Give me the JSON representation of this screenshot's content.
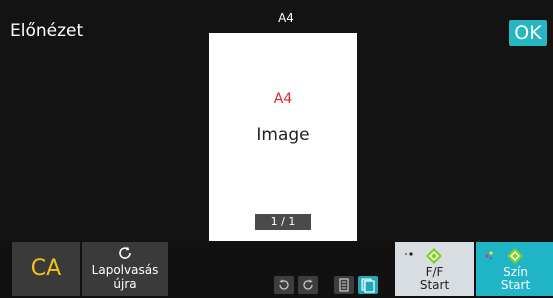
{
  "header": {
    "title": "Előnézet",
    "paper_size": "A4",
    "ok_label": "OK"
  },
  "preview": {
    "size_text": "A4",
    "image_text": "Image",
    "page_counter": "1 / 1"
  },
  "toolbar": {
    "ca_label": "CA",
    "rescan_line1": "Lapolvasás",
    "rescan_line2": "újra",
    "rotate_left_icon": "rotate-left-icon",
    "rotate_right_icon": "rotate-right-icon",
    "single_page_icon": "single-page-view-icon",
    "multi_page_icon": "multi-page-view-icon"
  },
  "start_buttons": {
    "bw_line1": "F/F",
    "bw_line2": "Start",
    "color_line1": "Szín",
    "color_line2": "Start"
  },
  "colors": {
    "accent_teal": "#25b6c0",
    "ca_yellow": "#f2c21b",
    "size_red": "#e0242d",
    "start_green": "#7ed321"
  }
}
